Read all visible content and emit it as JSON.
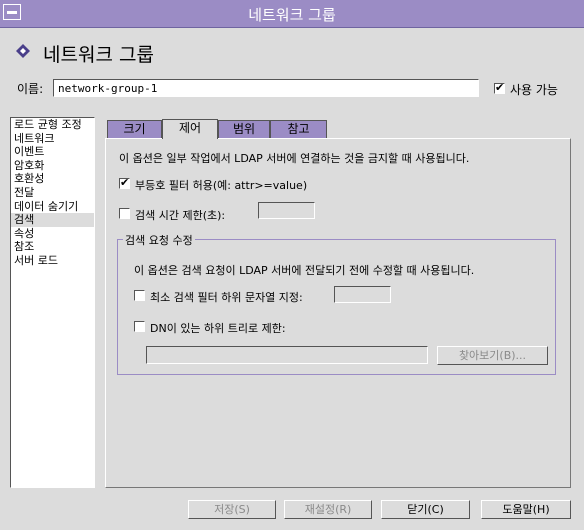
{
  "window": {
    "title": "네트워크 그룹"
  },
  "header": {
    "title": "네트워크 그룹"
  },
  "name": {
    "label": "이름:",
    "value": "network-group-1"
  },
  "enable": {
    "label": "사용 가능",
    "checked": true
  },
  "sidebar": {
    "items": [
      {
        "label": "로드 균형 조정"
      },
      {
        "label": "네트워크"
      },
      {
        "label": "이벤트"
      },
      {
        "label": "암호화"
      },
      {
        "label": "호환성"
      },
      {
        "label": "전달"
      },
      {
        "label": "데이터 숨기기"
      },
      {
        "label": "검색"
      },
      {
        "label": "속성"
      },
      {
        "label": "참조"
      },
      {
        "label": "서버 로드"
      }
    ],
    "selected": "검색"
  },
  "tabs": [
    {
      "label": "크기"
    },
    {
      "label": "제어"
    },
    {
      "label": "범위"
    },
    {
      "label": "참고"
    }
  ],
  "active_tab": "제어",
  "control": {
    "description": "이 옵션은 일부 작업에서 LDAP 서버에 연결하는 것을 금지할 때 사용됩니다.",
    "allow_inequality_filter": {
      "label": "부등호 필터 허용(예: attr>=value)",
      "checked": true
    },
    "limit_search_time": {
      "label": "검색 시간 제한(초):",
      "checked": false,
      "value": ""
    },
    "modify_search": {
      "legend": "검색 요청 수정",
      "description": "이 옵션은 검색 요청이 LDAP 서버에 전달되기 전에 수정할 때 사용됩니다.",
      "min_substring": {
        "label": "최소 검색 필터 하위 문자열 지정:",
        "checked": false,
        "value": ""
      },
      "restrict_subtree": {
        "label": "DN이 있는 하위 트리로 제한:",
        "checked": false,
        "value": ""
      },
      "browse_label": "찾아보기(B)..."
    }
  },
  "buttons": {
    "save": "저장(S)",
    "reset": "재설정(R)",
    "close": "닫기(C)",
    "help": "도움말(H)"
  },
  "colors": {
    "accent": "#9b8cc5",
    "background": "#dcdcdc"
  }
}
